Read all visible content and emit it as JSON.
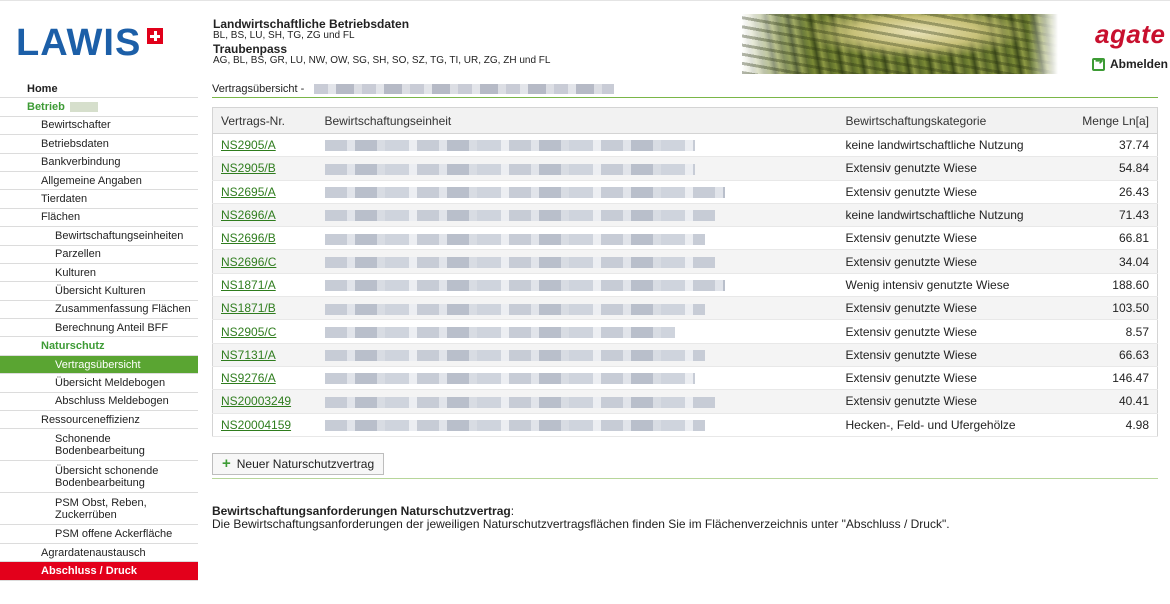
{
  "header": {
    "logo_text": "LAWIS",
    "title": "Landwirtschaftliche Betriebsdaten",
    "subtitle": "BL, BS, LU, SH, TG, ZG und FL",
    "title2": "Traubenpass",
    "subtitle2": "AG, BL, BS, GR, LU, NW, OW, SG, SH, SO, SZ, TG, TI, UR, ZG, ZH und FL",
    "partner_logo": "agate",
    "logout_label": "Abmelden"
  },
  "sidebar": {
    "home": "Home",
    "betrieb": "Betrieb",
    "bewirtschafter": "Bewirtschafter",
    "betriebsdaten": "Betriebsdaten",
    "bankverbindung": "Bankverbindung",
    "allgemeine_angaben": "Allgemeine Angaben",
    "tierdaten": "Tierdaten",
    "flaechen": "Flächen",
    "bewirtschaftungseinheiten": "Bewirtschaftungseinheiten",
    "parzellen": "Parzellen",
    "kulturen": "Kulturen",
    "uebersicht_kulturen": "Übersicht Kulturen",
    "zusammenfassung_flaechen": "Zusammenfassung Flächen",
    "berechnung_bff": "Berechnung Anteil BFF",
    "naturschutz": "Naturschutz",
    "vertragsuebersicht": "Vertragsübersicht",
    "uebersicht_meldebogen": "Übersicht Meldebogen",
    "abschluss_meldebogen": "Abschluss Meldebogen",
    "ressourceneffizienz": "Ressourceneffizienz",
    "schonende_bodenbearbeitung": "Schonende Bodenbearbeitung",
    "uebersicht_schonende": "Übersicht schonende Bodenbearbeitung",
    "psm_obst": "PSM Obst, Reben, Zuckerrüben",
    "psm_offene": "PSM offene Ackerfläche",
    "agrardatenaustausch": "Agrardatenaustausch",
    "abschluss_druck": "Abschluss / Druck"
  },
  "main": {
    "breadcrumb": "Vertragsübersicht -",
    "table": {
      "col_nr": "Vertrags-Nr.",
      "col_einheit": "Bewirtschaftungseinheit",
      "col_kategorie": "Bewirtschaftungskategorie",
      "col_menge": "Menge Ln[a]",
      "rows": [
        {
          "nr": "NS2905/A",
          "kategorie": "keine landwirtschaftliche Nutzung",
          "menge": "37.74"
        },
        {
          "nr": "NS2905/B",
          "kategorie": "Extensiv genutzte Wiese",
          "menge": "54.84"
        },
        {
          "nr": "NS2695/A",
          "kategorie": "Extensiv genutzte Wiese",
          "menge": "26.43"
        },
        {
          "nr": "NS2696/A",
          "kategorie": "keine landwirtschaftliche Nutzung",
          "menge": "71.43"
        },
        {
          "nr": "NS2696/B",
          "kategorie": "Extensiv genutzte Wiese",
          "menge": "66.81"
        },
        {
          "nr": "NS2696/C",
          "kategorie": "Extensiv genutzte Wiese",
          "menge": "34.04"
        },
        {
          "nr": "NS1871/A",
          "kategorie": "Wenig intensiv genutzte Wiese",
          "menge": "188.60"
        },
        {
          "nr": "NS1871/B",
          "kategorie": "Extensiv genutzte Wiese",
          "menge": "103.50"
        },
        {
          "nr": "NS2905/C",
          "kategorie": "Extensiv genutzte Wiese",
          "menge": "8.57"
        },
        {
          "nr": "NS7131/A",
          "kategorie": "Extensiv genutzte Wiese",
          "menge": "66.63"
        },
        {
          "nr": "NS9276/A",
          "kategorie": "Extensiv genutzte Wiese",
          "menge": "146.47"
        },
        {
          "nr": "NS20003249",
          "kategorie": "Extensiv genutzte Wiese",
          "menge": "40.41"
        },
        {
          "nr": "NS20004159",
          "kategorie": "Hecken-, Feld- und Ufergehölze",
          "menge": "4.98"
        }
      ]
    },
    "new_contract_label": "Neuer Naturschutzvertrag",
    "requirements_title": "Bewirtschaftungsanforderungen Naturschutzvertrag",
    "requirements_text": "Die Bewirtschaftungsanforderungen der jeweiligen Naturschutzvertragsflächen finden Sie im Flächenverzeichnis unter \"Abschluss / Druck\"."
  }
}
